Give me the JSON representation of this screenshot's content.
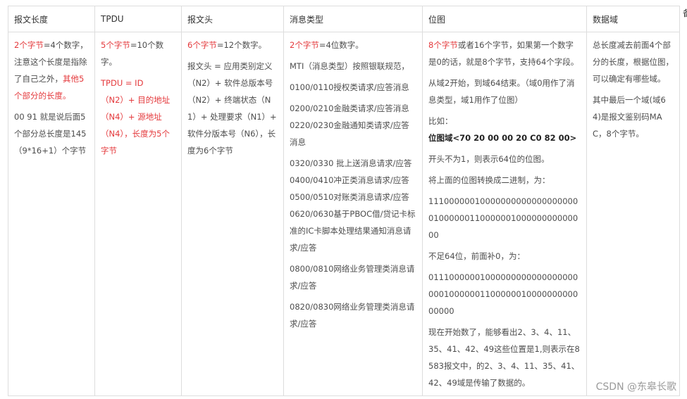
{
  "headers": [
    "报文长度",
    "TPDU",
    "报文头",
    "消息类型",
    "位图",
    "数据域"
  ],
  "cut_header_char": "备",
  "col1": {
    "p1_red_a": "2个字节",
    "p1_a": "=4个数字，注意这个长度是指除了自己之外，",
    "p1_red_b": "其他5个部分的长度。",
    "p2": "00 91 就是说后面5个部分总长度是145（9*16+1）个字节"
  },
  "col2": {
    "p1_red": "5个字节",
    "p1": "=10个数字。",
    "l1": "TPDU = ID",
    "l2": "（N2）+ 目的地址",
    "l3": "（N4）+ 源地址",
    "l4": "（N4），长度为5个字节"
  },
  "col3": {
    "p1_red": "6个字节",
    "p1": "=12个数字。",
    "p2": "报文头 = 应用类别定义（N2）+ 软件总版本号（N2）+ 终端状态（N1）+ 处理要求（N1）+ 软件分版本号（N6），长度为6个字节"
  },
  "col4": {
    "p1_red": "2个字节",
    "p1": "=4位数字。",
    "p2": "MTI（消息类型）按照银联规范，",
    "p3": "0100/0110授权类请求/应答消息",
    "p4": "0200/0210金融类请求/应答消息 0220/0230金融通知类请求/应答消息",
    "p5": "0320/0330 批上送消息请求/应答 0400/0410冲正类消息请求/应答 0500/0510对账类消息请求/应答 0620/0630基于PBOC借/贷记卡标准的IC卡脚本处理结果通知消息请求/应答",
    "p6": "0800/0810网络业务管理类消息请求/应答",
    "p7": "0820/0830网络业务管理类消息请求/应答"
  },
  "col5": {
    "p1_red": "8个字节",
    "p1": "或者16个字节，如果第一个数字是0的话，就是8个字节，支持64个字段。",
    "p2": "从域2开始，到域64结束。（域0用作了消息类型，域1用作了位图）",
    "p3_a": "比如：",
    "p3_b": "位图域<70 20 00 00 20 C0 82 00>",
    "p4": "开头不为1，则表示64位的位图。",
    "p5": "将上面的位图转换成二进制，为：",
    "p6": "111000000100000000000000000000100000011000000100000000000000",
    "p7": "不足64位，前面补0，为：",
    "p8": "011100000010000000000000000000001000000110000001000000000000000",
    "p9": "现在开始数了，能够看出2、3、4、11、35、41、42、49这些位置是1,则表示在8583报文中，的2、3、4、11、35、41、42、49域是传输了数据的。"
  },
  "col6": {
    "p1": "总长度减去前面4个部分的长度，根据位图，可以确定有哪些域。",
    "p2": "其中最后一个域(域64)是报文鉴别码MAC，8个字节。"
  },
  "watermark": "CSDN @东皋长歌"
}
